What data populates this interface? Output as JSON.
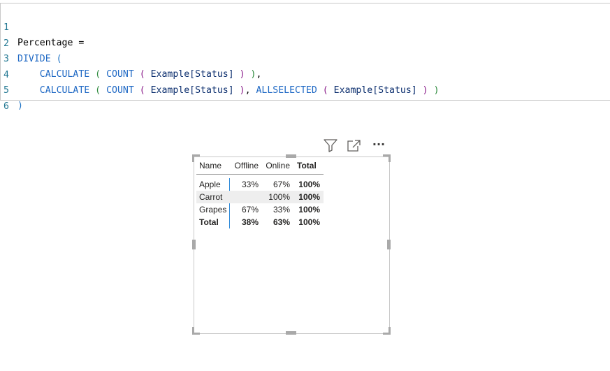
{
  "editor": {
    "line_numbers": [
      "1",
      "2",
      "3",
      "4",
      "5",
      "6"
    ],
    "line1": {
      "name": "Percentage",
      "eq": " ="
    },
    "line2": {
      "fn": "DIVIDE",
      "paren": " ("
    },
    "line3": {
      "calc": "CALCULATE",
      "p1": " ( ",
      "count": "COUNT",
      "p2": " ( ",
      "col": "Example[Status]",
      "p2c": " )",
      "p1c": " )",
      "tail": ","
    },
    "line4": {
      "calc": "CALCULATE",
      "p1": " ( ",
      "count": "COUNT",
      "p2": " ( ",
      "col": "Example[Status]",
      "p2c": " )",
      "comma": ", ",
      "allsel": "ALLSELECTED",
      "p3": " ( ",
      "col2": "Example[Status]",
      "p3c": " )",
      "p1c": " )"
    },
    "line5": {
      "paren": ")"
    }
  },
  "visual_header": {
    "icons": [
      "filter-icon",
      "focus-mode-icon",
      "more-options-icon"
    ],
    "more_label": "···"
  },
  "matrix": {
    "columns": [
      "Name",
      "Offline",
      "Online",
      "Total"
    ],
    "rows": [
      {
        "name": "Apple",
        "offline": "33%",
        "online": "67%",
        "total": "100%"
      },
      {
        "name": "Carrot",
        "offline": "",
        "online": "100%",
        "total": "100%"
      },
      {
        "name": "Grapes",
        "offline": "67%",
        "online": "33%",
        "total": "100%"
      }
    ],
    "total_row": {
      "name": "Total",
      "offline": "38%",
      "online": "63%",
      "total": "100%"
    }
  },
  "colors": {
    "line_number": "#237893",
    "keyword": "#1e68c4",
    "paren_level1": "#1f74c6",
    "paren_level2": "#2c8a3c",
    "paren_level3": "#8b1d8b",
    "column_ref": "#0b2e6e",
    "row_highlight": "#eeeeee",
    "row_header_divider": "#2b88d8"
  }
}
